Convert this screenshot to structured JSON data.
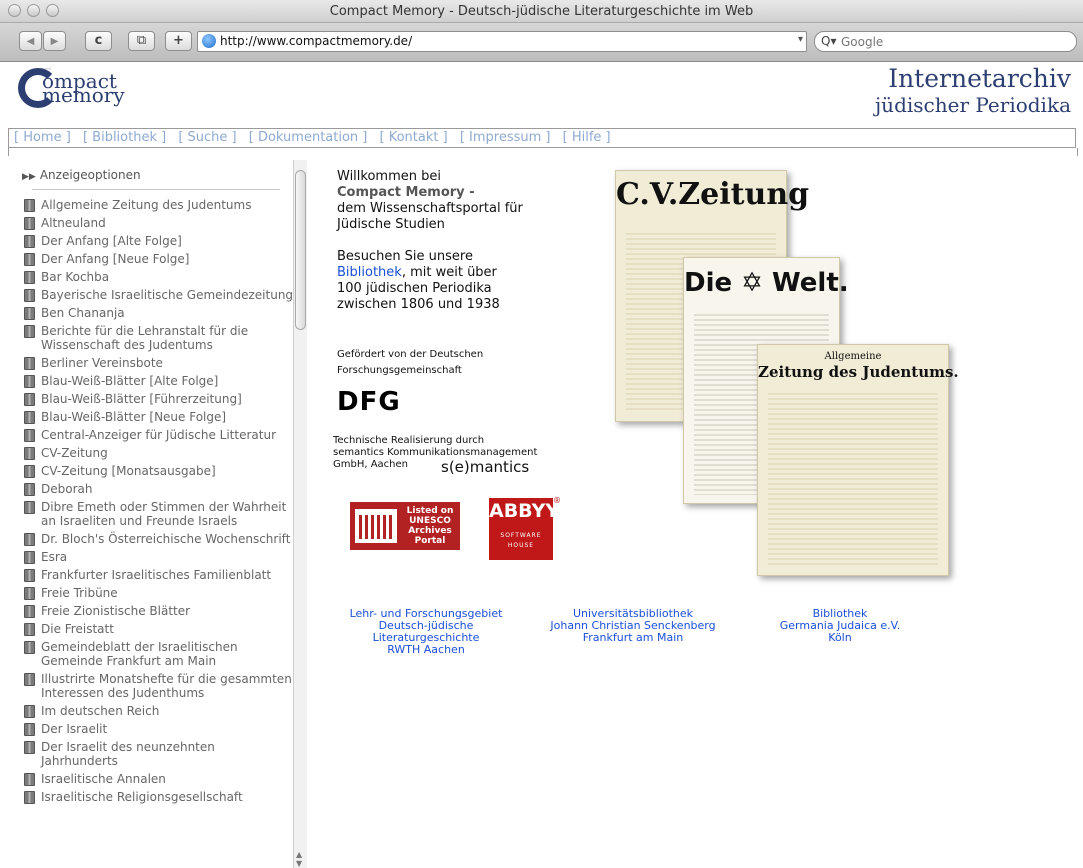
{
  "window": {
    "title": "Compact Memory - Deutsch-jüdische Literaturgeschichte im Web"
  },
  "toolbar": {
    "back": "◀",
    "forward": "▶",
    "reload": "c",
    "snap": "⧉",
    "add": "+",
    "url": "http://www.compactmemory.de/",
    "search_placeholder": "Google",
    "search_icon": "Q▾"
  },
  "header": {
    "logo_line1": "ompact",
    "logo_line2": "memory",
    "brand_title": "Internetarchiv",
    "brand_subtitle": "jüdischer Periodika"
  },
  "nav": [
    {
      "label": "[ Home ]"
    },
    {
      "label": "[ Bibliothek ]"
    },
    {
      "label": "[ Suche ]"
    },
    {
      "label": "[ Dokumentation ]"
    },
    {
      "label": "[ Kontakt ]"
    },
    {
      "label": "[ Impressum ]"
    },
    {
      "label": "[ Hilfe ]"
    }
  ],
  "sidebar": {
    "options_label": "Anzeigeoptionen",
    "items": [
      "Allgemeine Zeitung des Judentums",
      "Altneuland",
      "Der Anfang [Alte Folge]",
      "Der Anfang [Neue Folge]",
      "Bar Kochba",
      "Bayerische Israelitische Gemeindezeitung",
      "Ben Chananja",
      "Berichte für die Lehranstalt für die Wissenschaft des Judentums",
      "Berliner Vereinsbote",
      "Blau-Weiß-Blätter [Alte Folge]",
      "Blau-Weiß-Blätter [Führerzeitung]",
      "Blau-Weiß-Blätter [Neue Folge]",
      "Central-Anzeiger für Jüdische Litteratur",
      "CV-Zeitung",
      "CV-Zeitung [Monatsausgabe]",
      "Deborah",
      "Dibre Emeth oder Stimmen der Wahrheit an Israeliten und Freunde Israels",
      "Dr. Bloch's Österreichische Wochenschrift",
      "Esra",
      "Frankfurter Israelitisches Familienblatt",
      "Freie Tribüne",
      "Freie Zionistische Blätter",
      "Die Freistatt",
      "Gemeindeblatt der Israelitischen Gemeinde Frankfurt am Main",
      "Illustrirte Monatshefte für die gesammten Interessen des Judenthums",
      "Im deutschen Reich",
      "Der Israelit",
      "Der Israelit des neunzehnten Jahrhunderts",
      "Israelitische Annalen",
      "Israelitische Religionsgesellschaft"
    ]
  },
  "welcome": {
    "line1": "Willkommen bei",
    "line2": "Compact Memory",
    "line2_suffix": " -",
    "line3": "dem Wissenschaftsportal für",
    "line4": "Jüdische Studien",
    "visit_prefix": "Besuchen Sie unsere",
    "visit_link": "Bibliothek",
    "visit_suffix": ", mit weit über",
    "visit_line2": "100 jüdischen Periodika",
    "visit_line3": "zwischen 1806 und 1938"
  },
  "sponsor": {
    "line1": "Gefördert von der Deutschen",
    "line2": "Forschungsgemeinschaft",
    "dfg": "DFG"
  },
  "tech": {
    "line1": "Technische Realisierung durch",
    "line2": "semantics Kommunikationsmanagement",
    "line3": "GmbH, Aachen",
    "semantics_logo": "s(e)mantics"
  },
  "badges": {
    "unesco": "Listed on UNESCO Archives Portal",
    "abbyy": "ABBYY",
    "abbyy_sub1": "SOFTWARE",
    "abbyy_sub2": "HOUSE",
    "abbyy_reg": "®"
  },
  "papers": {
    "cv": "C.V.Zeitung",
    "welt": "Die ✡ Welt.",
    "azdj_small": "Allgemeine",
    "azdj": "Zeitung des Judentums."
  },
  "partners": [
    {
      "lines": [
        "Lehr- und Forschungsgebiet",
        "Deutsch-jüdische",
        "Literaturgeschichte",
        "RWTH Aachen"
      ]
    },
    {
      "lines": [
        "Universitätsbibliothek",
        "Johann Christian Senckenberg",
        "Frankfurt am Main"
      ]
    },
    {
      "lines": [
        "Bibliothek",
        "Germania Judaica e.V.",
        "Köln"
      ]
    }
  ],
  "colors": {
    "brand": "#2d3f72",
    "link": "#1a4fd8",
    "nav": "#8faad0"
  }
}
